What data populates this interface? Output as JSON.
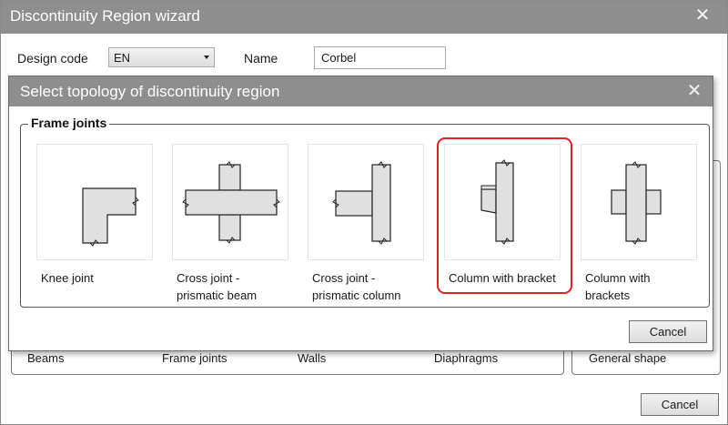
{
  "wizard": {
    "title": "Discontinuity Region wizard",
    "design_code_label": "Design code",
    "design_code_value": "EN",
    "name_label": "Name",
    "name_value": "Corbel",
    "categories": [
      "Beams",
      "Frame joints",
      "Walls",
      "Diaphragms",
      "General shape"
    ],
    "cancel_label": "Cancel"
  },
  "dialog": {
    "title": "Select topology of discontinuity region",
    "group_label": "Frame joints",
    "cancel_label": "Cancel",
    "topologies": [
      {
        "label": "Knee joint",
        "icon": "knee-joint-icon",
        "selected": false
      },
      {
        "label": "Cross joint - prismatic beam",
        "icon": "cross-joint-beam-icon",
        "selected": false
      },
      {
        "label": "Cross joint - prismatic column",
        "icon": "cross-joint-column-icon",
        "selected": false
      },
      {
        "label": "Column with bracket",
        "icon": "column-bracket-icon",
        "selected": true
      },
      {
        "label": "Column with brackets",
        "icon": "column-brackets-icon",
        "selected": false
      }
    ]
  },
  "colors": {
    "titlebar": "#8e8e8e",
    "selection": "#e0202a",
    "shape_fill": "#e0e0e0"
  }
}
